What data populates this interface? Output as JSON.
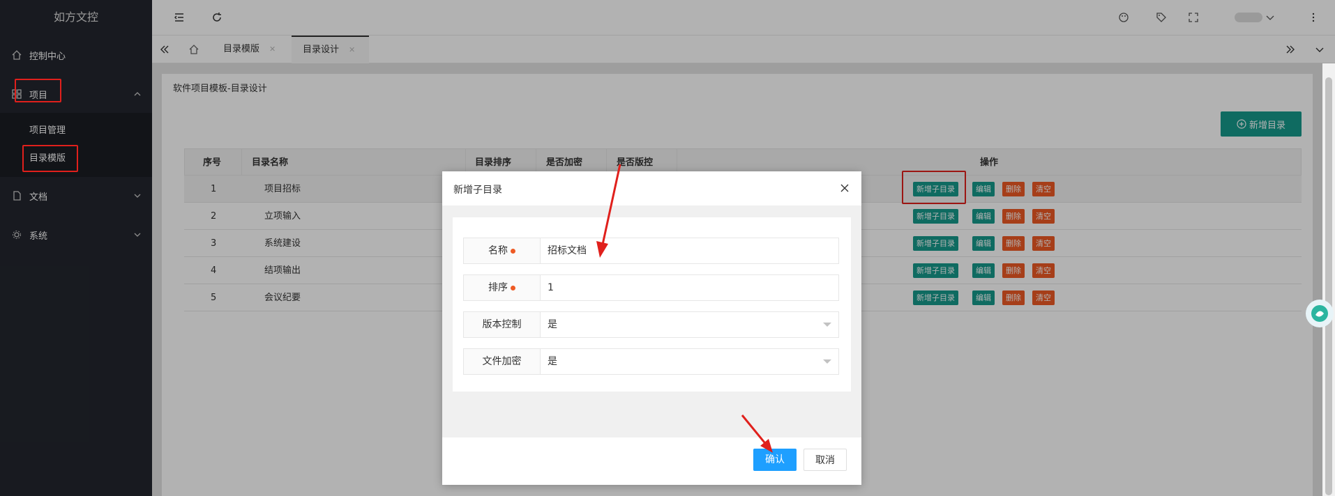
{
  "app": {
    "title": "如方文控"
  },
  "sidebar": {
    "items": [
      {
        "label": "控制中心",
        "icon": "home-icon"
      },
      {
        "label": "项目",
        "icon": "grid-icon"
      },
      {
        "label": "文档",
        "icon": "document-icon"
      },
      {
        "label": "系统",
        "icon": "gear-icon"
      }
    ],
    "sub_items": [
      {
        "label": "项目管理"
      },
      {
        "label": "目录模版"
      }
    ]
  },
  "tabs": [
    {
      "label": "目录模版"
    },
    {
      "label": "目录设计"
    }
  ],
  "page": {
    "title": "软件项目模板-目录设计",
    "add_button": "新增目录"
  },
  "table": {
    "headers": [
      "序号",
      "目录名称",
      "目录排序",
      "是否加密",
      "是否版控",
      "操作"
    ],
    "rows": [
      {
        "index": "1",
        "name": "项目招标"
      },
      {
        "index": "2",
        "name": "立项输入"
      },
      {
        "index": "3",
        "name": "系统建设"
      },
      {
        "index": "4",
        "name": "结项输出"
      },
      {
        "index": "5",
        "name": "会议纪要"
      }
    ],
    "actions": [
      "新增子目录",
      "编辑",
      "删除",
      "清空"
    ]
  },
  "modal": {
    "title": "新增子目录",
    "fields": [
      {
        "label": "名称",
        "value": "招标文档",
        "required": true
      },
      {
        "label": "排序",
        "value": "1",
        "required": true
      },
      {
        "label": "版本控制",
        "value": "是",
        "required": false
      },
      {
        "label": "文件加密",
        "value": "是",
        "required": false
      }
    ],
    "confirm": "确认",
    "cancel": "取消"
  },
  "colors": {
    "sidebar_bg": "#23262e",
    "accent_green": "#169a8c",
    "accent_orange": "#ee5a24",
    "confirm_blue": "#1e9fff",
    "annotation_red": "#e0201c"
  }
}
